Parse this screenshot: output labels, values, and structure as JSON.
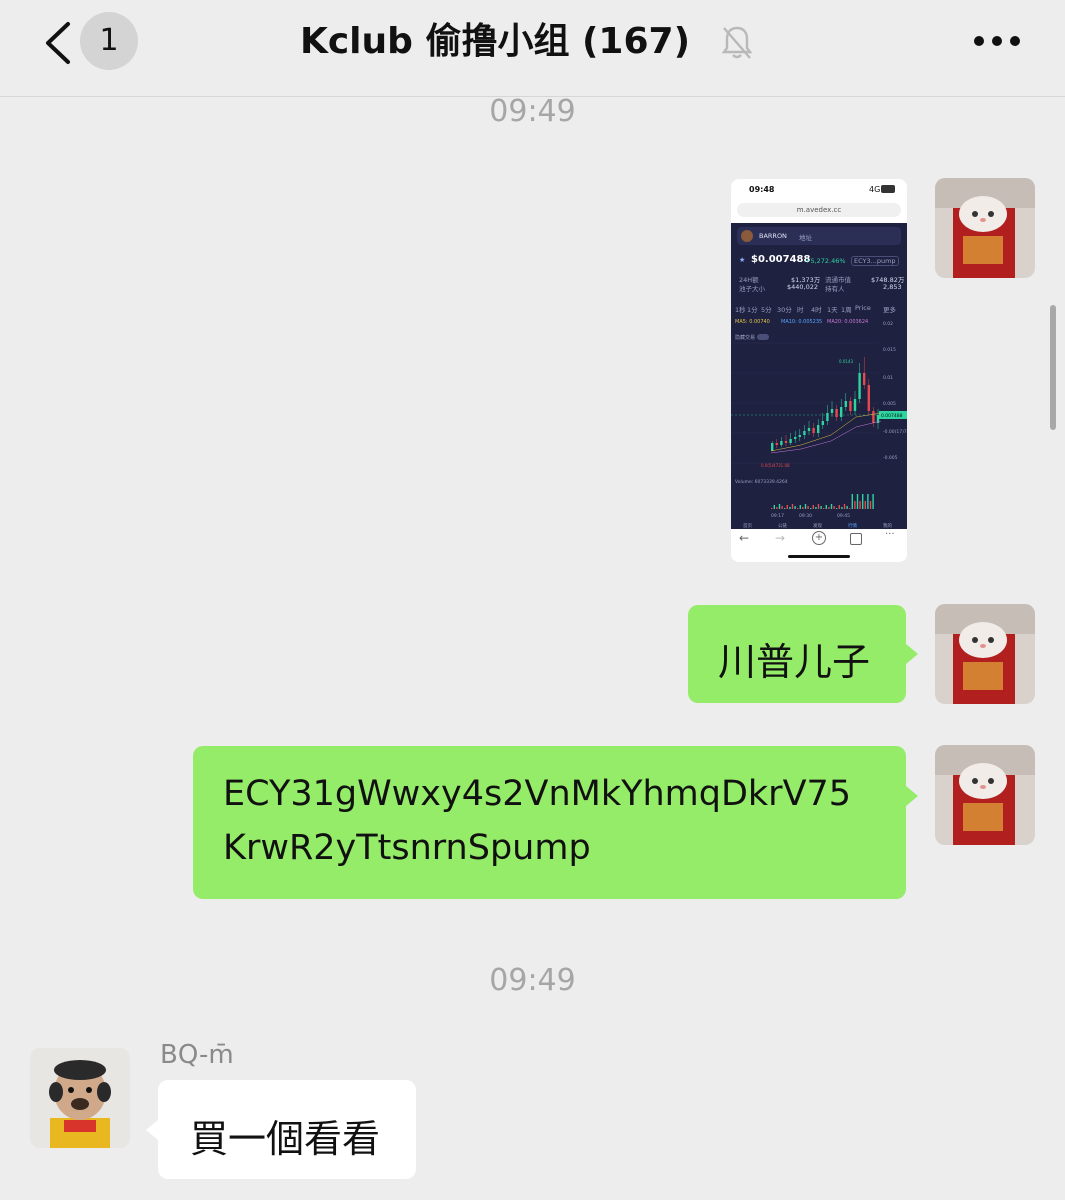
{
  "header": {
    "back_icon": "chevron-left-icon",
    "unread_count": "1",
    "title": "Kclub 偷撸小组 (167)",
    "mute_icon": "bell-off-icon",
    "more_icon": "more-dots-icon"
  },
  "messages": {
    "time_1": "09:49",
    "image_msg": {
      "status_time": "09:48",
      "signal": "4G",
      "url": "m.avedex.cc",
      "token_name": "BARRON",
      "search_placeholder": "地址",
      "price": "$0.007488",
      "change": "+5,272.46%",
      "contract_tag": "ECY3...pump",
      "stat1_label": "24H额",
      "stat1_value": "$1,373万",
      "stat2_label": "流通市值",
      "stat2_value": "$748.82万",
      "stat3_label": "池子大小",
      "stat3_value": "$440,022",
      "stat4_label": "持有人",
      "stat4_value": "2,853",
      "tabs": [
        "1秒",
        "1分",
        "5分",
        "30分",
        "时",
        "4时",
        "1天",
        "1周"
      ],
      "price_dropdown": "Price",
      "more_tab": "更多",
      "ma_labels": [
        "MA5: 0.00740",
        "MA10: 0.005235",
        "MA20: 0.003624"
      ],
      "hide_orders": "隐藏交易",
      "y_ticks": [
        "0.02",
        "0.015",
        "0.01",
        "0.005",
        "-0.00(17)7",
        "-0.005"
      ],
      "price_tag": "0.007488",
      "peak_label": "0.0143",
      "low_label": "0.0(5)4731.08",
      "volume_label": "Volume: 6073339.4264",
      "x_ticks": [
        "09:17",
        "09:30",
        "09:45"
      ],
      "nav": [
        "首页",
        "公链",
        "发现",
        "行情",
        "我的"
      ]
    },
    "msg_1": "川普儿子",
    "msg_2_line1": "ECY31gWwxy4s2VnMkYhmqDkrV75",
    "msg_2_line2": "KrwR2yTtsnrnSpump",
    "time_2": "09:49",
    "sender_name": "BQ-m̄",
    "msg_3": "買一個看看"
  },
  "colors": {
    "background": "#ededed",
    "my_bubble": "#95ec69",
    "other_bubble": "#ffffff",
    "time_text": "#a6a6a6",
    "chart_bg": "#1e2140",
    "candle_up": "#2ed3a0",
    "candle_down": "#e5484d"
  }
}
